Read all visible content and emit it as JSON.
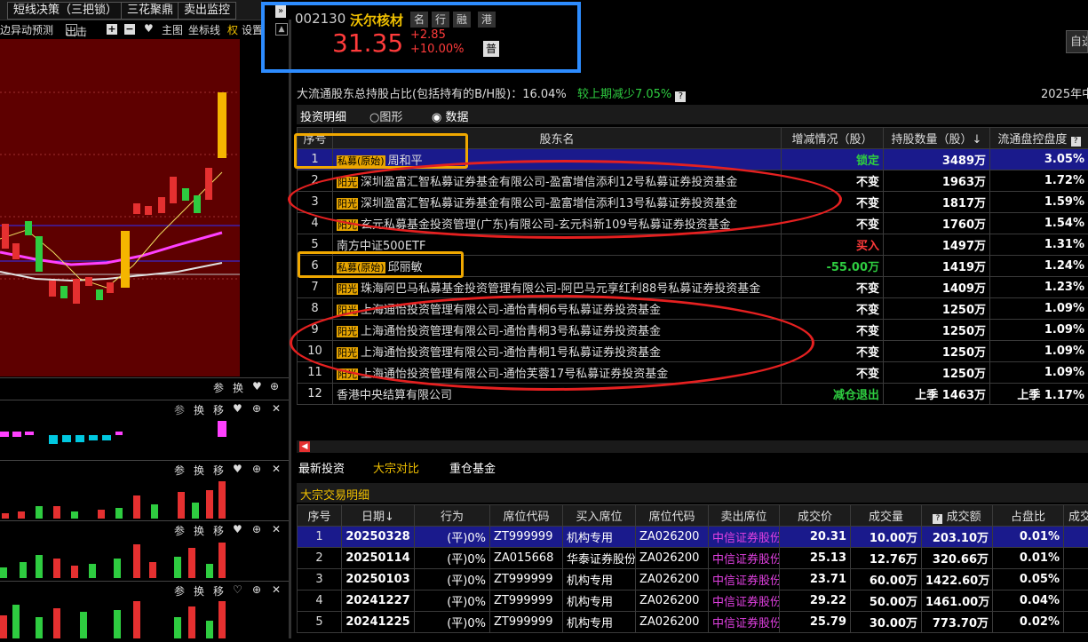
{
  "top_tabs": [
    "短线决策（三把锁）",
    "三花聚鼎",
    "卖出监控"
  ],
  "toolbar": {
    "dong": "边异动预测",
    "chuzhu": "出击",
    "zhutu": "主图",
    "zuobiao": "坐标线",
    "quan": "权",
    "shezhi": "设置"
  },
  "panel_bars": {
    "p1": [
      "参",
      "换"
    ],
    "p2": [
      "参",
      "换",
      "移"
    ],
    "p3": [
      "参",
      "换",
      "移"
    ],
    "p4": [
      "参",
      "换",
      "移"
    ],
    "p5": [
      "参",
      "换",
      "移"
    ]
  },
  "stock": {
    "code": "002130",
    "name": "沃尔核材",
    "tags": [
      "名",
      "行",
      "融",
      "港"
    ],
    "price": "31.35",
    "change": "+2.85",
    "change_pct": "+10.00%",
    "pu": "普",
    "right_btn": "自选"
  },
  "holders_summary": {
    "label": "大流通股东总持股占比(包括持有的B/H股)：16.04%",
    "compare": "较上期减少7.05%",
    "period": "2025年中"
  },
  "holders_tabs": {
    "detail": "投资明细",
    "graph": "图形",
    "data": "数据"
  },
  "holders_columns": [
    "序号",
    "股东名",
    "增减情况（股）",
    "持股数量（股）↓",
    "流通盘控盘度"
  ],
  "holders_rows": [
    {
      "no": "1",
      "tag": "私募(原始)",
      "name": "周和平",
      "chg": "锁定",
      "qty": "3489万",
      "pct": "3.05%"
    },
    {
      "no": "2",
      "tag": "阳光",
      "name": "深圳盈富汇智私募证券基金有限公司-盈富增信添利12号私募证券投资基金",
      "chg": "不变",
      "qty": "1963万",
      "pct": "1.72%"
    },
    {
      "no": "3",
      "tag": "阳光",
      "name": "深圳盈富汇智私募证券基金有限公司-盈富增信添利13号私募证券投资基金",
      "chg": "不变",
      "qty": "1817万",
      "pct": "1.59%"
    },
    {
      "no": "4",
      "tag": "阳光",
      "name": "玄元私募基金投资管理(广东)有限公司-玄元科新109号私募证券投资基金",
      "chg": "不变",
      "qty": "1760万",
      "pct": "1.54%"
    },
    {
      "no": "5",
      "tag": "",
      "name": "南方中证500ETF",
      "chg": "买入",
      "qty": "1497万",
      "pct": "1.31%"
    },
    {
      "no": "6",
      "tag": "私募(原始)",
      "name": "邱丽敏",
      "chg": "-55.00万",
      "qty": "1419万",
      "pct": "1.24%"
    },
    {
      "no": "7",
      "tag": "阳光",
      "name": "珠海阿巴马私募基金投资管理有限公司-阿巴马元享红利88号私募证券投资基金",
      "chg": "不变",
      "qty": "1409万",
      "pct": "1.23%"
    },
    {
      "no": "8",
      "tag": "阳光",
      "name": "上海通怡投资管理有限公司-通怡青桐6号私募证券投资基金",
      "chg": "不变",
      "qty": "1250万",
      "pct": "1.09%"
    },
    {
      "no": "9",
      "tag": "阳光",
      "name": "上海通怡投资管理有限公司-通怡青桐3号私募证券投资基金",
      "chg": "不变",
      "qty": "1250万",
      "pct": "1.09%"
    },
    {
      "no": "10",
      "tag": "阳光",
      "name": "上海通怡投资管理有限公司-通怡青桐1号私募证券投资基金",
      "chg": "不变",
      "qty": "1250万",
      "pct": "1.09%"
    },
    {
      "no": "11",
      "tag": "阳光",
      "name": "上海通怡投资管理有限公司-通怡芙蓉17号私募证券投资基金",
      "chg": "不变",
      "qty": "1250万",
      "pct": "1.09%"
    },
    {
      "no": "12",
      "tag": "",
      "name": "香港中央结算有限公司",
      "chg": "减仓退出",
      "qty": "上季 1463万",
      "pct": "上季 1.17%"
    }
  ],
  "bottom_tabs": [
    "最新投资",
    "大宗对比",
    "重仓基金"
  ],
  "block_title": "大宗交易明细",
  "block_columns": [
    "序号",
    "日期↓",
    "行为",
    "席位代码",
    "买入席位",
    "席位代码",
    "卖出席位",
    "成交价",
    "成交量",
    "成交额",
    "占盘比",
    "成交"
  ],
  "block_rows": [
    {
      "no": "1",
      "date": "20250328",
      "act": "(平)0%",
      "bcode": "ZT999999",
      "buyer": "机构专用",
      "scode": "ZA026200",
      "seller": "中信证券股份",
      "price": "20.31",
      "vol": "10.00万",
      "amt": "203.10万",
      "ratio": "0.01%"
    },
    {
      "no": "2",
      "date": "20250114",
      "act": "(平)0%",
      "bcode": "ZA015668",
      "buyer": "华泰证券股份",
      "scode": "ZA026200",
      "seller": "中信证券股份",
      "price": "25.13",
      "vol": "12.76万",
      "amt": "320.66万",
      "ratio": "0.01%"
    },
    {
      "no": "3",
      "date": "20250103",
      "act": "(平)0%",
      "bcode": "ZT999999",
      "buyer": "机构专用",
      "scode": "ZA026200",
      "seller": "中信证券股份",
      "price": "23.71",
      "vol": "60.00万",
      "amt": "1422.60万",
      "ratio": "0.05%"
    },
    {
      "no": "4",
      "date": "20241227",
      "act": "(平)0%",
      "bcode": "ZT999999",
      "buyer": "机构专用",
      "scode": "ZA026200",
      "seller": "中信证券股份",
      "price": "29.22",
      "vol": "50.00万",
      "amt": "1461.00万",
      "ratio": "0.04%"
    },
    {
      "no": "5",
      "date": "20241225",
      "act": "(平)0%",
      "bcode": "ZT999999",
      "buyer": "机构专用",
      "scode": "ZA026200",
      "seller": "中信证券股份",
      "price": "25.79",
      "vol": "30.00万",
      "amt": "773.70万",
      "ratio": "0.02%"
    }
  ],
  "colors": {
    "up": "#ff3b3b",
    "down": "#2ecc40",
    "accent_box": "#2d8cff",
    "annot_orange": "#f0a800",
    "annot_red": "#e52020"
  }
}
